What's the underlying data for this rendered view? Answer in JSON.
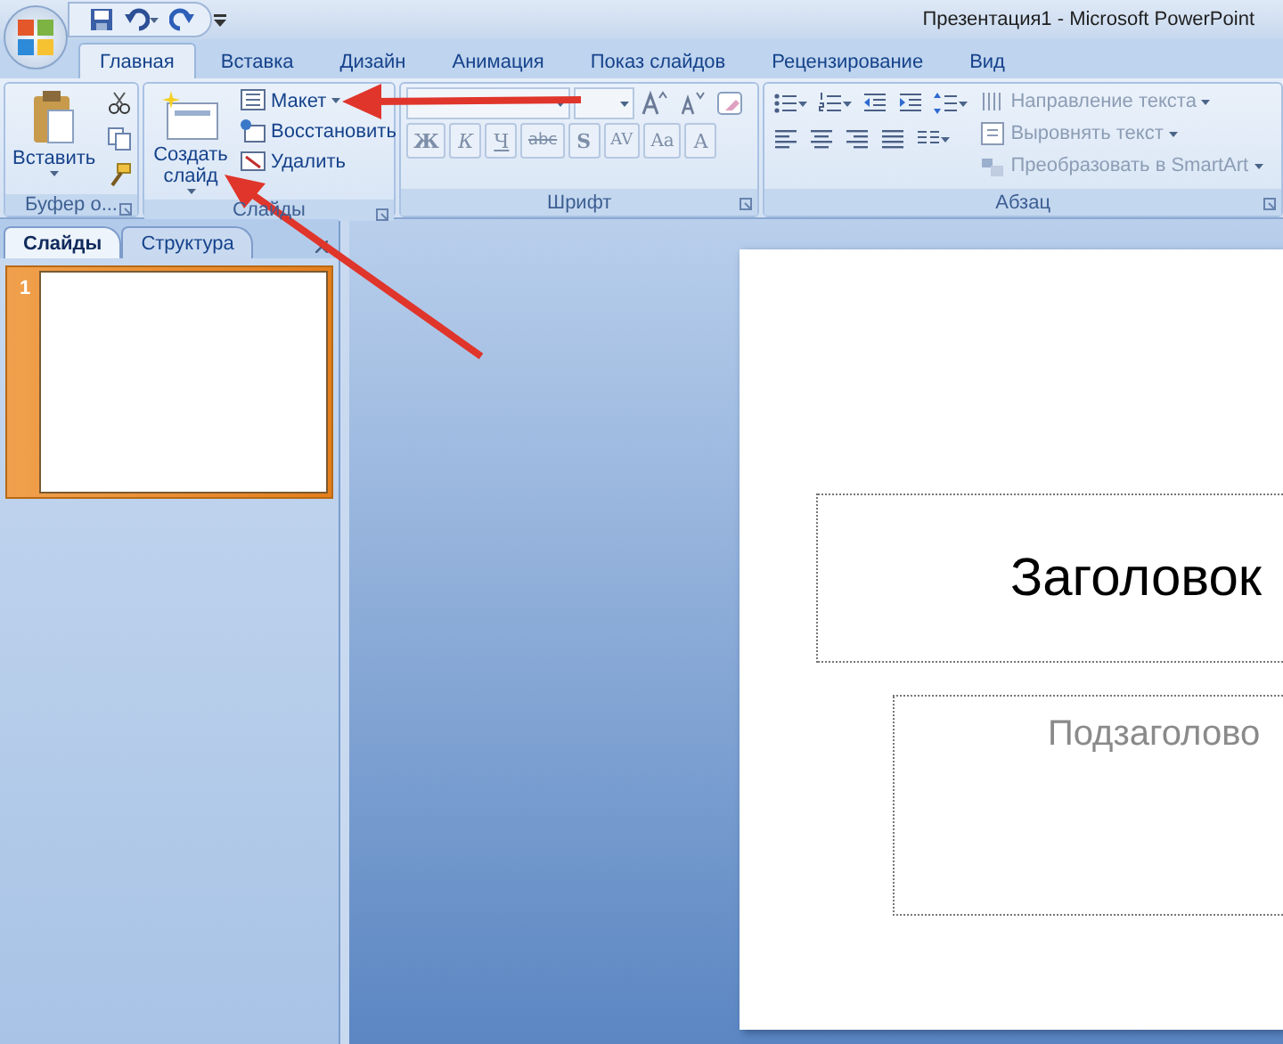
{
  "window": {
    "title": "Презентация1 - Microsoft PowerPoint"
  },
  "tabs": [
    {
      "label": "Главная",
      "selected": true
    },
    {
      "label": "Вставка",
      "selected": false
    },
    {
      "label": "Дизайн",
      "selected": false
    },
    {
      "label": "Анимация",
      "selected": false
    },
    {
      "label": "Показ слайдов",
      "selected": false
    },
    {
      "label": "Рецензирование",
      "selected": false
    },
    {
      "label": "Вид",
      "selected": false
    }
  ],
  "ribbon": {
    "clipboard": {
      "paste": "Вставить",
      "label": "Буфер о..."
    },
    "slides": {
      "new_slide": "Создать слайд",
      "layout": "Макет",
      "reset": "Восстановить",
      "delete": "Удалить",
      "label": "Слайды"
    },
    "font": {
      "format_buttons": [
        "Ж",
        "К",
        "Ч",
        "abc",
        "S",
        "AV",
        "Aa",
        "A"
      ],
      "label": "Шрифт"
    },
    "paragraph": {
      "commands": [
        {
          "label": "Направление текста",
          "disabled": true
        },
        {
          "label": "Выровнять текст",
          "disabled": true
        },
        {
          "label": "Преобразовать в SmartArt",
          "disabled": true
        }
      ],
      "label": "Абзац"
    }
  },
  "pane": {
    "tabs": [
      {
        "label": "Слайды",
        "selected": true
      },
      {
        "label": "Структура",
        "selected": false
      }
    ],
    "thumbnails": [
      {
        "number": "1",
        "selected": true
      }
    ]
  },
  "slide": {
    "title_placeholder": "Заголовок",
    "subtitle_placeholder": "Подзаголово"
  }
}
